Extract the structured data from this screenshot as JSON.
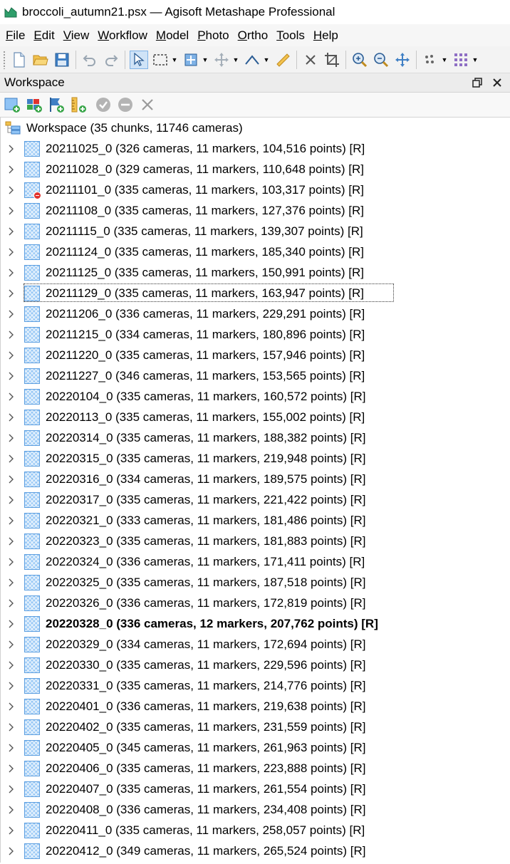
{
  "window": {
    "title": "broccoli_autumn21.psx — Agisoft Metashape Professional"
  },
  "menu": [
    {
      "label": "File",
      "acc": "F",
      "rest": "ile"
    },
    {
      "label": "Edit",
      "acc": "E",
      "rest": "dit"
    },
    {
      "label": "View",
      "acc": "V",
      "rest": "iew"
    },
    {
      "label": "Workflow",
      "acc": "W",
      "rest": "orkflow"
    },
    {
      "label": "Model",
      "acc": "M",
      "rest": "odel"
    },
    {
      "label": "Photo",
      "acc": "P",
      "rest": "hoto"
    },
    {
      "label": "Ortho",
      "acc": "O",
      "rest": "rtho"
    },
    {
      "label": "Tools",
      "acc": "T",
      "rest": "ools"
    },
    {
      "label": "Help",
      "acc": "H",
      "rest": "elp"
    }
  ],
  "workspace": {
    "title": "Workspace",
    "root_label": "Workspace (35 chunks, 11746 cameras)",
    "chunks": [
      {
        "label": "20211025_0 (326 cameras, 11 markers, 104,516 points) [R]"
      },
      {
        "label": "20211028_0 (329 cameras, 11 markers, 110,648 points) [R]"
      },
      {
        "label": "20211101_0 (335 cameras, 11 markers, 103,317 points) [R]",
        "disabled": true
      },
      {
        "label": "20211108_0 (335 cameras, 11 markers, 127,376 points) [R]"
      },
      {
        "label": "20211115_0 (335 cameras, 11 markers, 139,307 points) [R]"
      },
      {
        "label": "20211124_0 (335 cameras, 11 markers, 185,340 points) [R]"
      },
      {
        "label": "20211125_0 (335 cameras, 11 markers, 150,991 points) [R]"
      },
      {
        "label": "20211129_0 (335 cameras, 11 markers, 163,947 points) [R]",
        "focused": true
      },
      {
        "label": "20211206_0 (336 cameras, 11 markers, 229,291 points) [R]"
      },
      {
        "label": "20211215_0 (334 cameras, 11 markers, 180,896 points) [R]"
      },
      {
        "label": "20211220_0 (335 cameras, 11 markers, 157,946 points) [R]"
      },
      {
        "label": "20211227_0 (346 cameras, 11 markers, 153,565 points) [R]"
      },
      {
        "label": "20220104_0 (335 cameras, 11 markers, 160,572 points) [R]"
      },
      {
        "label": "20220113_0 (335 cameras, 11 markers, 155,002 points) [R]"
      },
      {
        "label": "20220314_0 (335 cameras, 11 markers, 188,382 points) [R]"
      },
      {
        "label": "20220315_0 (335 cameras, 11 markers, 219,948 points) [R]"
      },
      {
        "label": "20220316_0 (334 cameras, 11 markers, 189,575 points) [R]"
      },
      {
        "label": "20220317_0 (335 cameras, 11 markers, 221,422 points) [R]"
      },
      {
        "label": "20220321_0 (333 cameras, 11 markers, 181,486 points) [R]"
      },
      {
        "label": "20220323_0 (335 cameras, 11 markers, 181,883 points) [R]"
      },
      {
        "label": "20220324_0 (336 cameras, 11 markers, 171,411 points) [R]"
      },
      {
        "label": "20220325_0 (335 cameras, 11 markers, 187,518 points) [R]"
      },
      {
        "label": "20220326_0 (336 cameras, 11 markers, 172,819 points) [R]"
      },
      {
        "label": "20220328_0 (336 cameras, 12 markers, 207,762 points) [R]",
        "active": true
      },
      {
        "label": "20220329_0 (334 cameras, 11 markers, 172,694 points) [R]"
      },
      {
        "label": "20220330_0 (335 cameras, 11 markers, 229,596 points) [R]"
      },
      {
        "label": "20220331_0 (335 cameras, 11 markers, 214,776 points) [R]"
      },
      {
        "label": "20220401_0 (336 cameras, 11 markers, 219,638 points) [R]"
      },
      {
        "label": "20220402_0 (335 cameras, 11 markers, 231,559 points) [R]"
      },
      {
        "label": "20220405_0 (345 cameras, 11 markers, 261,963 points) [R]"
      },
      {
        "label": "20220406_0 (335 cameras, 11 markers, 223,888 points) [R]"
      },
      {
        "label": "20220407_0 (335 cameras, 11 markers, 261,554 points) [R]"
      },
      {
        "label": "20220408_0 (336 cameras, 11 markers, 234,408 points) [R]"
      },
      {
        "label": "20220411_0 (335 cameras, 11 markers, 258,057 points) [R]"
      },
      {
        "label": "20220412_0 (349 cameras, 11 markers, 265,524 points) [R]"
      }
    ]
  },
  "icons": {
    "app": "metashape-icon",
    "toolbar": [
      "new-document-icon",
      "open-folder-icon",
      "save-icon",
      "undo-icon",
      "redo-icon",
      "select-pointer-icon",
      "rect-select-icon",
      "navigation-icon",
      "move-icon",
      "polyline-icon",
      "ruler-icon",
      "delete-icon",
      "crop-icon",
      "zoom-in-icon",
      "zoom-out-icon",
      "reset-view-icon",
      "point-cloud-icon",
      "grid-icon"
    ],
    "panel_toolbar": [
      "add-chunk-icon",
      "add-photos-icon",
      "add-marker-icon",
      "add-scalebar-icon",
      "enable-icon",
      "disable-icon",
      "remove-icon"
    ]
  },
  "colors": {
    "chunk_icon": "#8fc3f5",
    "selected_button": "#cfe3f7",
    "disabled_badge": "#e0322e"
  }
}
